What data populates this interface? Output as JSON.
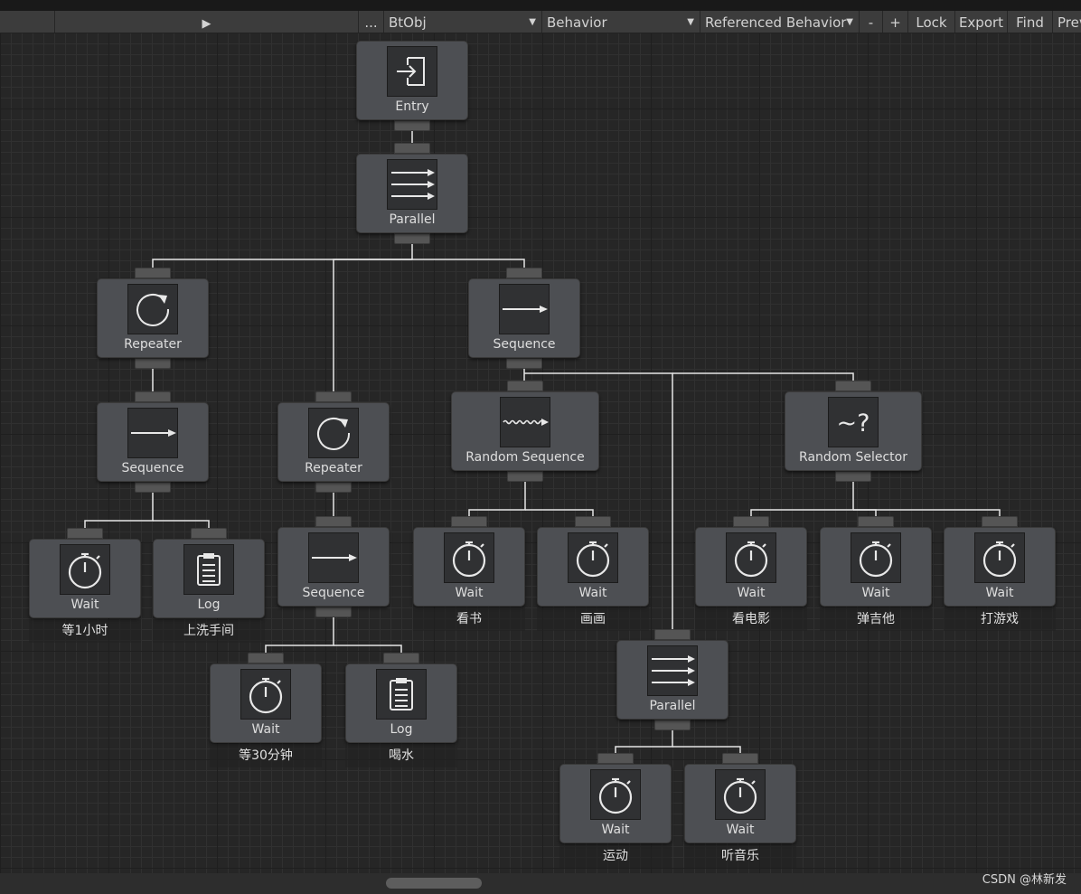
{
  "toolbar": {
    "play_glyph": "▶",
    "more_label": "...",
    "object_select": "BtObj",
    "behavior_select": "Behavior",
    "referenced_select": "Referenced Behavior",
    "zoom_out_label": "-",
    "zoom_in_label": "+",
    "lock_label": "Lock",
    "export_label": "Export",
    "find_label": "Find",
    "preview_label": "Prev"
  },
  "nodes": {
    "entry": {
      "title": "Entry",
      "icon": "entry-icon"
    },
    "parallel_root": {
      "title": "Parallel",
      "icon": "parallel-icon"
    },
    "repeater_1": {
      "title": "Repeater",
      "icon": "repeat-icon"
    },
    "sequence_top": {
      "title": "Sequence",
      "icon": "sequence-icon"
    },
    "sequence_1": {
      "title": "Sequence",
      "icon": "sequence-icon"
    },
    "repeater_2": {
      "title": "Repeater",
      "icon": "repeat-icon"
    },
    "random_sequence": {
      "title": "Random Sequence",
      "icon": "random-sequence-icon"
    },
    "random_selector": {
      "title": "Random Selector",
      "icon": "random-selector-icon"
    },
    "sequence_2": {
      "title": "Sequence",
      "icon": "sequence-icon"
    },
    "wait_hour": {
      "title": "Wait",
      "icon": "stopwatch-icon",
      "caption": "等1小时"
    },
    "log_wash": {
      "title": "Log",
      "icon": "clipboard-icon",
      "caption": "上洗手间"
    },
    "wait_book": {
      "title": "Wait",
      "icon": "stopwatch-icon",
      "caption": "看书"
    },
    "wait_paint": {
      "title": "Wait",
      "icon": "stopwatch-icon",
      "caption": "画画"
    },
    "wait_movie": {
      "title": "Wait",
      "icon": "stopwatch-icon",
      "caption": "看电影"
    },
    "wait_guitar": {
      "title": "Wait",
      "icon": "stopwatch-icon",
      "caption": "弹吉他"
    },
    "wait_game": {
      "title": "Wait",
      "icon": "stopwatch-icon",
      "caption": "打游戏"
    },
    "wait_30min": {
      "title": "Wait",
      "icon": "stopwatch-icon",
      "caption": "等30分钟"
    },
    "log_drink": {
      "title": "Log",
      "icon": "clipboard-icon",
      "caption": "喝水"
    },
    "parallel_2": {
      "title": "Parallel",
      "icon": "parallel-icon"
    },
    "wait_sport": {
      "title": "Wait",
      "icon": "stopwatch-icon",
      "caption": "运动"
    },
    "wait_music": {
      "title": "Wait",
      "icon": "stopwatch-icon",
      "caption": "听音乐"
    }
  },
  "watermark": "CSDN @林新发",
  "colors": {
    "canvas": "#262626",
    "node": "#4d4f53",
    "edge": "#e6e6e6"
  }
}
